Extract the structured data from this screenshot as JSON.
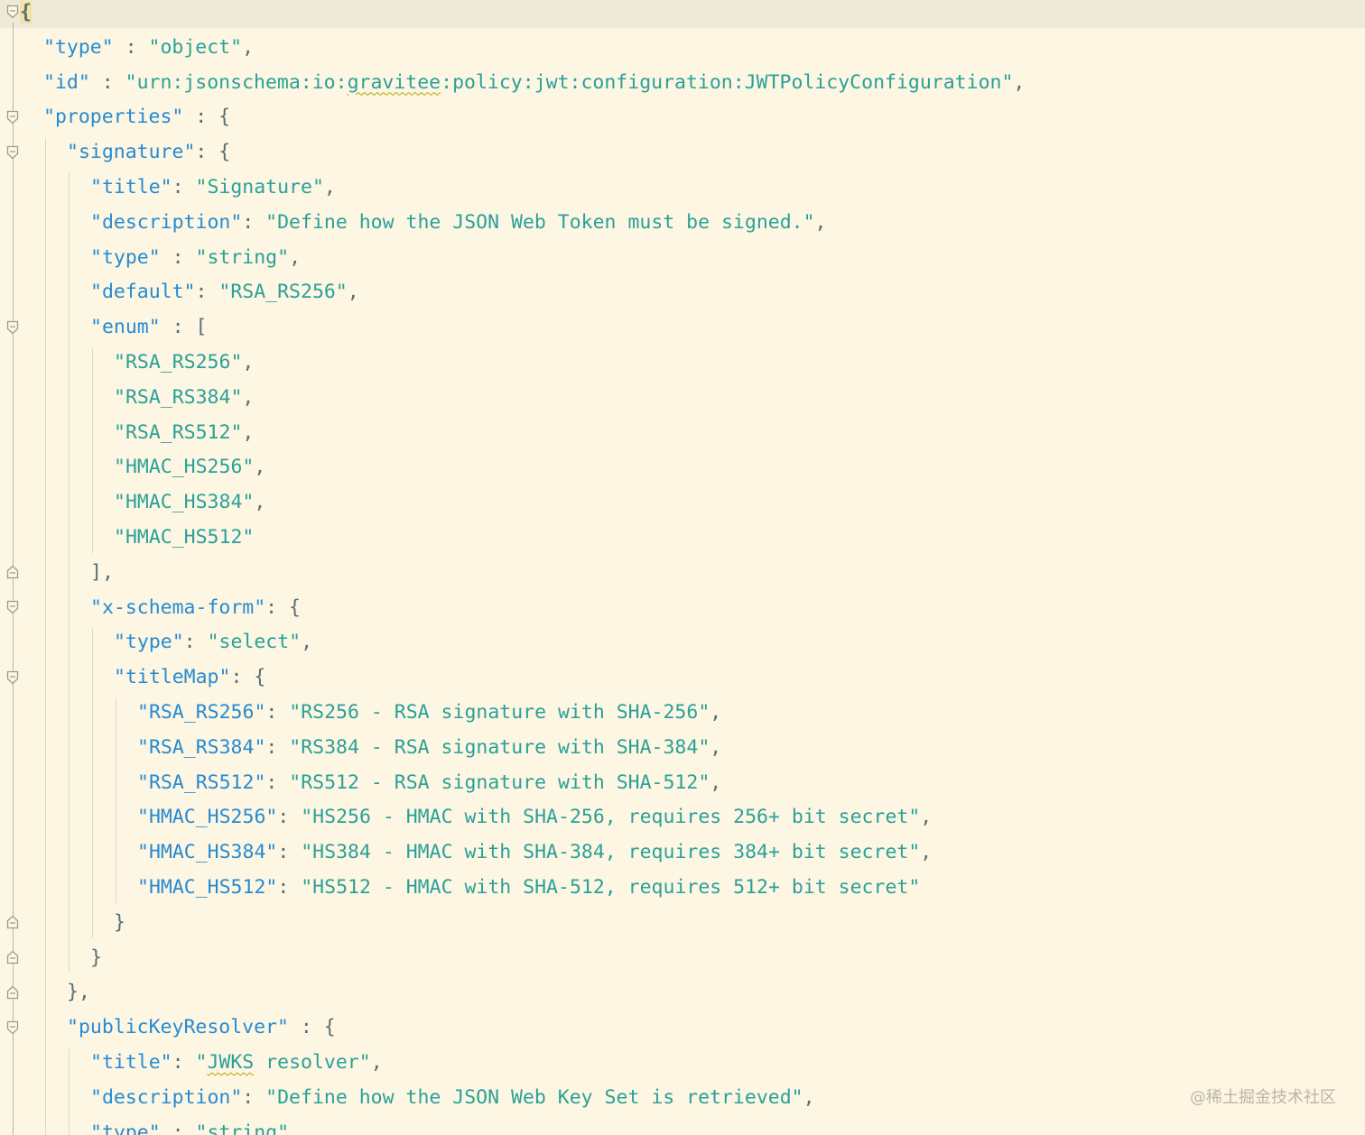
{
  "editor": {
    "lines": [
      {
        "indent": 0,
        "tokens": [
          {
            "t": "{",
            "c": "brace-hl"
          }
        ]
      },
      {
        "indent": 1,
        "tokens": [
          {
            "t": "\"type\"",
            "c": "k"
          },
          {
            "t": " : ",
            "c": "p"
          },
          {
            "t": "\"object\"",
            "c": "s"
          },
          {
            "t": ",",
            "c": "p"
          }
        ]
      },
      {
        "indent": 1,
        "tokens": [
          {
            "t": "\"id\"",
            "c": "k"
          },
          {
            "t": " : ",
            "c": "p"
          },
          {
            "t": "\"urn:jsonschema:io:",
            "c": "s"
          },
          {
            "t": "gravitee",
            "c": "s squig"
          },
          {
            "t": ":policy:jwt:configuration:JWTPolicyConfiguration\"",
            "c": "s"
          },
          {
            "t": ",",
            "c": "p"
          }
        ]
      },
      {
        "indent": 1,
        "tokens": [
          {
            "t": "\"properties\"",
            "c": "k"
          },
          {
            "t": " : {",
            "c": "p"
          }
        ]
      },
      {
        "indent": 2,
        "tokens": [
          {
            "t": "\"signature\"",
            "c": "k"
          },
          {
            "t": ": {",
            "c": "p"
          }
        ]
      },
      {
        "indent": 3,
        "tokens": [
          {
            "t": "\"title\"",
            "c": "k"
          },
          {
            "t": ": ",
            "c": "p"
          },
          {
            "t": "\"Signature\"",
            "c": "s"
          },
          {
            "t": ",",
            "c": "p"
          }
        ]
      },
      {
        "indent": 3,
        "tokens": [
          {
            "t": "\"description\"",
            "c": "k"
          },
          {
            "t": ": ",
            "c": "p"
          },
          {
            "t": "\"Define how the JSON Web Token must be signed.\"",
            "c": "s"
          },
          {
            "t": ",",
            "c": "p"
          }
        ]
      },
      {
        "indent": 3,
        "tokens": [
          {
            "t": "\"type\"",
            "c": "k"
          },
          {
            "t": " : ",
            "c": "p"
          },
          {
            "t": "\"string\"",
            "c": "s"
          },
          {
            "t": ",",
            "c": "p"
          }
        ]
      },
      {
        "indent": 3,
        "tokens": [
          {
            "t": "\"default\"",
            "c": "k"
          },
          {
            "t": ": ",
            "c": "p"
          },
          {
            "t": "\"RSA_RS256\"",
            "c": "s"
          },
          {
            "t": ",",
            "c": "p"
          }
        ]
      },
      {
        "indent": 3,
        "tokens": [
          {
            "t": "\"enum\"",
            "c": "k"
          },
          {
            "t": " : [",
            "c": "p"
          }
        ]
      },
      {
        "indent": 4,
        "tokens": [
          {
            "t": "\"RSA_RS256\"",
            "c": "s"
          },
          {
            "t": ",",
            "c": "p"
          }
        ]
      },
      {
        "indent": 4,
        "tokens": [
          {
            "t": "\"RSA_RS384\"",
            "c": "s"
          },
          {
            "t": ",",
            "c": "p"
          }
        ]
      },
      {
        "indent": 4,
        "tokens": [
          {
            "t": "\"RSA_RS512\"",
            "c": "s"
          },
          {
            "t": ",",
            "c": "p"
          }
        ]
      },
      {
        "indent": 4,
        "tokens": [
          {
            "t": "\"HMAC_HS256\"",
            "c": "s"
          },
          {
            "t": ",",
            "c": "p"
          }
        ]
      },
      {
        "indent": 4,
        "tokens": [
          {
            "t": "\"HMAC_HS384\"",
            "c": "s"
          },
          {
            "t": ",",
            "c": "p"
          }
        ]
      },
      {
        "indent": 4,
        "tokens": [
          {
            "t": "\"HMAC_HS512\"",
            "c": "s"
          }
        ]
      },
      {
        "indent": 3,
        "tokens": [
          {
            "t": "],",
            "c": "p"
          }
        ]
      },
      {
        "indent": 3,
        "tokens": [
          {
            "t": "\"x-schema-form\"",
            "c": "k"
          },
          {
            "t": ": {",
            "c": "p"
          }
        ]
      },
      {
        "indent": 4,
        "tokens": [
          {
            "t": "\"type\"",
            "c": "k"
          },
          {
            "t": ": ",
            "c": "p"
          },
          {
            "t": "\"select\"",
            "c": "s"
          },
          {
            "t": ",",
            "c": "p"
          }
        ]
      },
      {
        "indent": 4,
        "tokens": [
          {
            "t": "\"titleMap\"",
            "c": "k"
          },
          {
            "t": ": {",
            "c": "p"
          }
        ]
      },
      {
        "indent": 5,
        "tokens": [
          {
            "t": "\"RSA_RS256\"",
            "c": "k"
          },
          {
            "t": ": ",
            "c": "p"
          },
          {
            "t": "\"RS256 - RSA signature with SHA-256\"",
            "c": "s"
          },
          {
            "t": ",",
            "c": "p"
          }
        ]
      },
      {
        "indent": 5,
        "tokens": [
          {
            "t": "\"RSA_RS384\"",
            "c": "k"
          },
          {
            "t": ": ",
            "c": "p"
          },
          {
            "t": "\"RS384 - RSA signature with SHA-384\"",
            "c": "s"
          },
          {
            "t": ",",
            "c": "p"
          }
        ]
      },
      {
        "indent": 5,
        "tokens": [
          {
            "t": "\"RSA_RS512\"",
            "c": "k"
          },
          {
            "t": ": ",
            "c": "p"
          },
          {
            "t": "\"RS512 - RSA signature with SHA-512\"",
            "c": "s"
          },
          {
            "t": ",",
            "c": "p"
          }
        ]
      },
      {
        "indent": 5,
        "tokens": [
          {
            "t": "\"HMAC_HS256\"",
            "c": "k"
          },
          {
            "t": ": ",
            "c": "p"
          },
          {
            "t": "\"HS256 - HMAC with SHA-256, requires 256+ bit secret\"",
            "c": "s"
          },
          {
            "t": ",",
            "c": "p"
          }
        ]
      },
      {
        "indent": 5,
        "tokens": [
          {
            "t": "\"HMAC_HS384\"",
            "c": "k"
          },
          {
            "t": ": ",
            "c": "p"
          },
          {
            "t": "\"HS384 - HMAC with SHA-384, requires 384+ bit secret\"",
            "c": "s"
          },
          {
            "t": ",",
            "c": "p"
          }
        ]
      },
      {
        "indent": 5,
        "tokens": [
          {
            "t": "\"HMAC_HS512\"",
            "c": "k"
          },
          {
            "t": ": ",
            "c": "p"
          },
          {
            "t": "\"HS512 - HMAC with SHA-512, requires 512+ bit secret\"",
            "c": "s"
          }
        ]
      },
      {
        "indent": 4,
        "tokens": [
          {
            "t": "}",
            "c": "p"
          }
        ]
      },
      {
        "indent": 3,
        "tokens": [
          {
            "t": "}",
            "c": "p"
          }
        ]
      },
      {
        "indent": 2,
        "tokens": [
          {
            "t": "},",
            "c": "p"
          }
        ]
      },
      {
        "indent": 2,
        "tokens": [
          {
            "t": "\"publicKeyResolver\"",
            "c": "k"
          },
          {
            "t": " : {",
            "c": "p"
          }
        ]
      },
      {
        "indent": 3,
        "tokens": [
          {
            "t": "\"title\"",
            "c": "k"
          },
          {
            "t": ": ",
            "c": "p"
          },
          {
            "t": "\"",
            "c": "s"
          },
          {
            "t": "JWKS",
            "c": "s squig"
          },
          {
            "t": " resolver\"",
            "c": "s"
          },
          {
            "t": ",",
            "c": "p"
          }
        ]
      },
      {
        "indent": 3,
        "tokens": [
          {
            "t": "\"description\"",
            "c": "k"
          },
          {
            "t": ": ",
            "c": "p"
          },
          {
            "t": "\"Define how the JSON Web Key Set is retrieved\"",
            "c": "s"
          },
          {
            "t": ",",
            "c": "p"
          }
        ]
      },
      {
        "indent": 3,
        "tokens": [
          {
            "t": "\"type\"",
            "c": "k"
          },
          {
            "t": " : ",
            "c": "p"
          },
          {
            "t": "\"string\"",
            "c": "s"
          },
          {
            "t": ",",
            "c": "p"
          }
        ]
      }
    ],
    "folds": [
      {
        "line": 0,
        "kind": "open"
      },
      {
        "line": 3,
        "kind": "open"
      },
      {
        "line": 4,
        "kind": "open"
      },
      {
        "line": 9,
        "kind": "open"
      },
      {
        "line": 16,
        "kind": "close"
      },
      {
        "line": 17,
        "kind": "open"
      },
      {
        "line": 19,
        "kind": "open"
      },
      {
        "line": 26,
        "kind": "close"
      },
      {
        "line": 27,
        "kind": "close"
      },
      {
        "line": 28,
        "kind": "close"
      },
      {
        "line": 29,
        "kind": "open"
      }
    ],
    "colors": {
      "background": "#FDF6E3",
      "current_line": "#EEE9D8",
      "key": "#268BD2",
      "string": "#2AA198",
      "punctuation": "#586E75"
    }
  },
  "watermark": "@稀土掘金技术社区"
}
